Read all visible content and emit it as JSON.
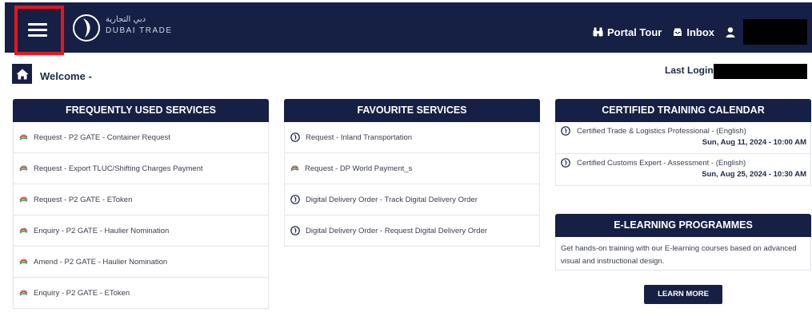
{
  "header": {
    "logo_arabic": "دبي التجارية",
    "logo_text": "DUBAI TRADE",
    "links": [
      {
        "label": "Portal Tour",
        "icon": "binoculars-icon"
      },
      {
        "label": "Inbox",
        "icon": "inbox-icon"
      }
    ],
    "user_icon": "user-icon",
    "user_name_redacted": ""
  },
  "welcome": {
    "text": "Welcome -",
    "last_login_label": "Last Login",
    "last_login_value_redacted": ""
  },
  "frequent": {
    "title": "FREQUENTLY USED SERVICES",
    "items": [
      "Request - P2 GATE - Container Request",
      "Request - Export TLUC/Shifting Charges Payment",
      "Request - P2 GATE - EToken",
      "Enquiry - P2 GATE - Haulier Nomination",
      "Amend - P2 GATE - Haulier Nomination",
      "Enquiry - P2 GATE - EToken"
    ]
  },
  "favourite": {
    "title": "FAVOURITE SERVICES",
    "items": [
      {
        "label": "Request - Inland Transportation",
        "icon": "dubai-trade-icon"
      },
      {
        "label": "Request - DP World Payment_s",
        "icon": "dp-world-icon"
      },
      {
        "label": "Digital Delivery Order - Track Digital Delivery Order",
        "icon": "dubai-trade-icon"
      },
      {
        "label": "Digital Delivery Order - Request Digital Delivery Order",
        "icon": "dubai-trade-icon"
      }
    ]
  },
  "training": {
    "title": "CERTIFIED TRAINING CALENDAR",
    "items": [
      {
        "title": "Certified Trade & Logistics Professional - (English)",
        "date": "Sun, Aug 11, 2024 - 10:00 AM"
      },
      {
        "title": "Certified Customs Expert - Assessment - (English)",
        "date": "Sun, Aug 25, 2024 - 10:30 AM"
      }
    ]
  },
  "elearning": {
    "title": "E-LEARNING PROGRAMMES",
    "description": "Get hands-on training with our E-learning courses based on advanced visual and instructional design.",
    "button": "LEARN MORE"
  },
  "colors": {
    "navy": "#162044",
    "highlight": "#e8151c",
    "border": "#e3e5ea"
  }
}
